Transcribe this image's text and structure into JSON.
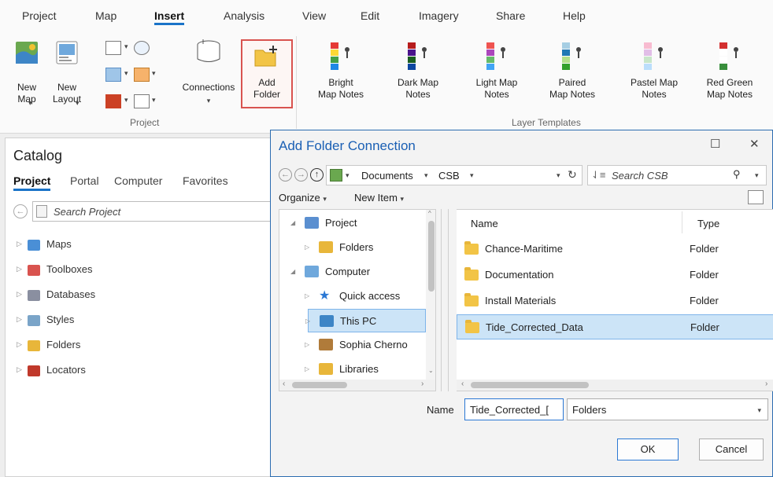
{
  "ribbon": {
    "tabs": [
      "Project",
      "Map",
      "Insert",
      "Analysis",
      "View",
      "Edit",
      "Imagery",
      "Share",
      "Help"
    ],
    "active_tab": "Insert",
    "project_group": {
      "label": "Project",
      "new_map": "New\nMap",
      "new_layout": "New\nLayout",
      "connections": "Connections",
      "add_folder": "Add\nFolder"
    },
    "layer_templates": {
      "label": "Layer Templates",
      "items": [
        {
          "label": "Bright\nMap Notes",
          "colors": [
            "#e53935",
            "#fdd835",
            "#43a047",
            "#1e88e5"
          ]
        },
        {
          "label": "Dark Map\nNotes",
          "colors": [
            "#b71c1c",
            "#4a148c",
            "#1b5e20",
            "#0d47a1"
          ]
        },
        {
          "label": "Light Map\nNotes",
          "colors": [
            "#ef5350",
            "#ab47bc",
            "#66bb6a",
            "#42a5f5"
          ]
        },
        {
          "label": "Paired\nMap Notes",
          "colors": [
            "#a6cee3",
            "#1f78b4",
            "#b2df8a",
            "#33a02c"
          ]
        },
        {
          "label": "Pastel Map\nNotes",
          "colors": [
            "#f8bbd0",
            "#e1bee7",
            "#c8e6c9",
            "#bbdefb"
          ]
        },
        {
          "label": "Red Green\nMap Notes",
          "colors": [
            "#d32f2f",
            "#ffffff",
            "#ffffff",
            "#388e3c"
          ]
        }
      ]
    }
  },
  "catalog": {
    "title": "Catalog",
    "tabs": [
      "Project",
      "Portal",
      "Computer",
      "Favorites"
    ],
    "active_tab": "Project",
    "search_placeholder": "Search Project",
    "tree": [
      {
        "label": "Maps",
        "icon": "maps-icon",
        "color": "#4a8fd6"
      },
      {
        "label": "Toolboxes",
        "icon": "toolbox-icon",
        "color": "#d9534f"
      },
      {
        "label": "Databases",
        "icon": "database-icon",
        "color": "#8a8fa0"
      },
      {
        "label": "Styles",
        "icon": "styles-icon",
        "color": "#7aa4c8"
      },
      {
        "label": "Folders",
        "icon": "folder-icon",
        "color": "#e8b63a"
      },
      {
        "label": "Locators",
        "icon": "locator-icon",
        "color": "#c0392b"
      }
    ]
  },
  "dialog": {
    "title": "Add Folder Connection",
    "breadcrumb": [
      "Documents",
      "CSB"
    ],
    "search_placeholder": "Search CSB",
    "toolbar": {
      "organize": "Organize",
      "new_item": "New Item"
    },
    "nav_tree": [
      {
        "label": "Project",
        "level": 0,
        "expanded": true,
        "icon": "project-icon"
      },
      {
        "label": "Folders",
        "level": 1,
        "expanded": false,
        "icon": "folder-icon"
      },
      {
        "label": "Computer",
        "level": 0,
        "expanded": true,
        "icon": "computer-icon"
      },
      {
        "label": "Quick access",
        "level": 1,
        "expanded": false,
        "icon": "star-icon"
      },
      {
        "label": "This PC",
        "level": 1,
        "expanded": false,
        "icon": "pc-icon",
        "selected": true
      },
      {
        "label": "Sophia Cherno",
        "level": 1,
        "expanded": false,
        "icon": "user-icon"
      },
      {
        "label": "Libraries",
        "level": 1,
        "expanded": false,
        "icon": "library-icon"
      }
    ],
    "columns": {
      "name": "Name",
      "type": "Type"
    },
    "files": [
      {
        "name": "Chance-Maritime",
        "type": "Folder"
      },
      {
        "name": "Documentation",
        "type": "Folder"
      },
      {
        "name": "Install Materials",
        "type": "Folder"
      },
      {
        "name": "Tide_Corrected_Data",
        "type": "Folder",
        "selected": true
      }
    ],
    "name_label": "Name",
    "name_value": "Tide_Corrected_[",
    "filter_value": "Folders",
    "ok_label": "OK",
    "cancel_label": "Cancel",
    "minimize": "☐",
    "close": "✕"
  }
}
